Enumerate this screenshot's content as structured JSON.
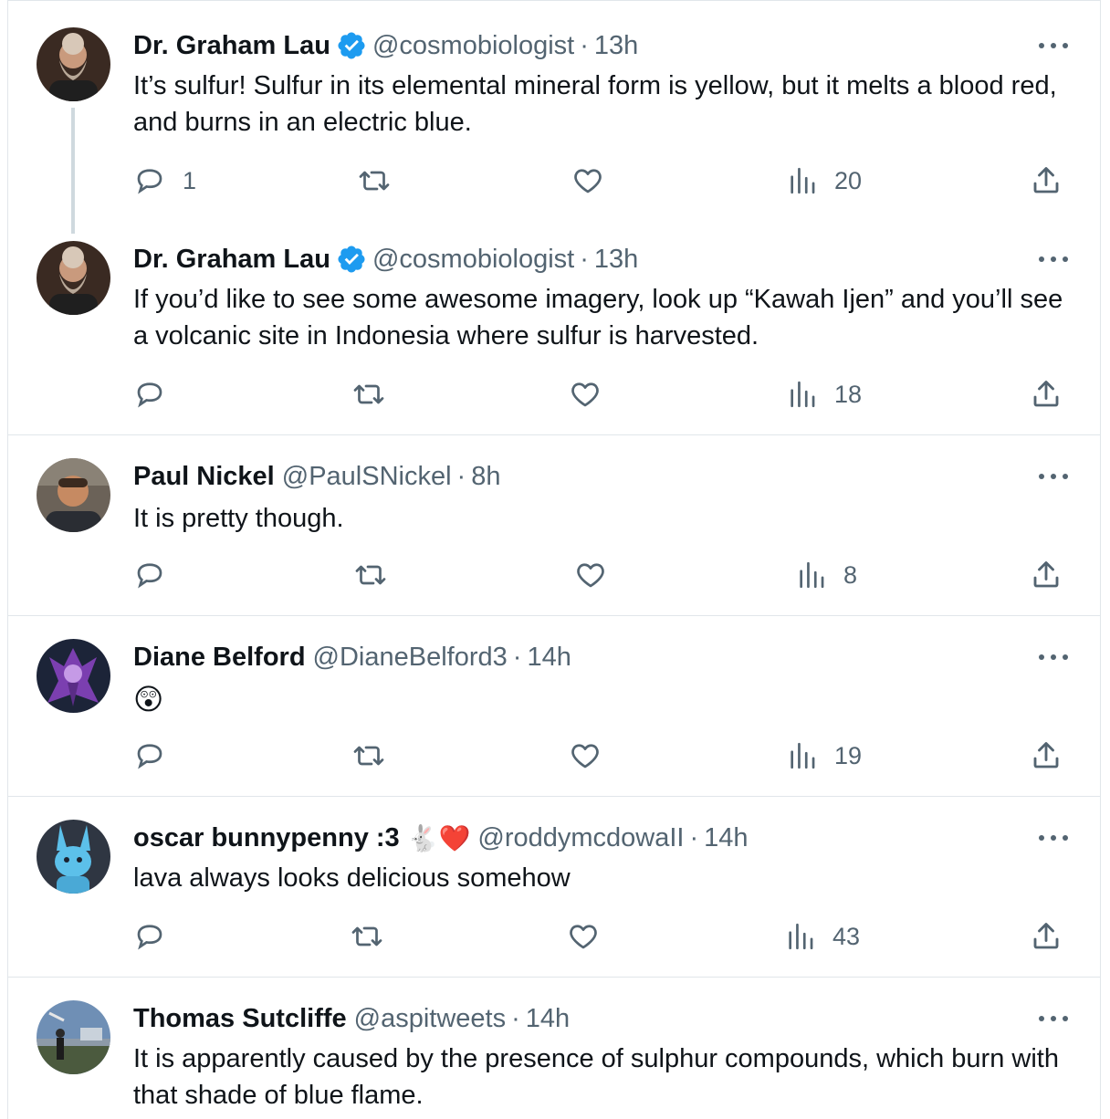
{
  "tweets": [
    {
      "name": "Dr. Graham Lau",
      "verified": true,
      "handle": "@cosmobiologist",
      "separator": "·",
      "time": "13h",
      "text": "It’s sulfur! Sulfur in its elemental mineral form is yellow, but it melts a blood red, and burns in an electric blue.",
      "replies": "1",
      "views": "20"
    },
    {
      "name": "Dr. Graham Lau",
      "verified": true,
      "handle": "@cosmobiologist",
      "separator": "·",
      "time": "13h",
      "text": "If you’d like to see some awesome imagery, look up “Kawah Ijen” and you’ll see a volcanic site in Indonesia where sulfur is harvested.",
      "replies": "",
      "views": "18"
    },
    {
      "name": "Paul Nickel",
      "verified": false,
      "handle": "@PaulSNickel",
      "separator": "·",
      "time": "8h",
      "text": "It is pretty though.",
      "replies": "",
      "views": "8"
    },
    {
      "name": "Diane Belford",
      "verified": false,
      "handle": "@DianeBelford3",
      "separator": "·",
      "time": "14h",
      "text": "😲",
      "replies": "",
      "views": "19"
    },
    {
      "name": "oscar bunnypenny :3",
      "name_emoji": "🐇❤️",
      "verified": false,
      "handle": "@roddymcdowaII",
      "separator": "·",
      "time": "14h",
      "text": "lava always looks delicious somehow",
      "replies": "",
      "views": "43"
    },
    {
      "name": "Thomas Sutcliffe",
      "verified": false,
      "handle": "@aspitweets",
      "separator": "·",
      "time": "14h",
      "text": "It is apparently caused by the presence of sulphur compounds, which burn with that shade of blue flame.",
      "replies": "",
      "views": ""
    }
  ],
  "colors": {
    "text": "#0f1419",
    "secondary": "#536471",
    "verified": "#1d9bf0",
    "border": "#e1e6ea"
  },
  "icons": [
    "reply-icon",
    "retweet-icon",
    "like-icon",
    "views-icon",
    "share-icon",
    "more-icon",
    "verified-badge-icon"
  ]
}
